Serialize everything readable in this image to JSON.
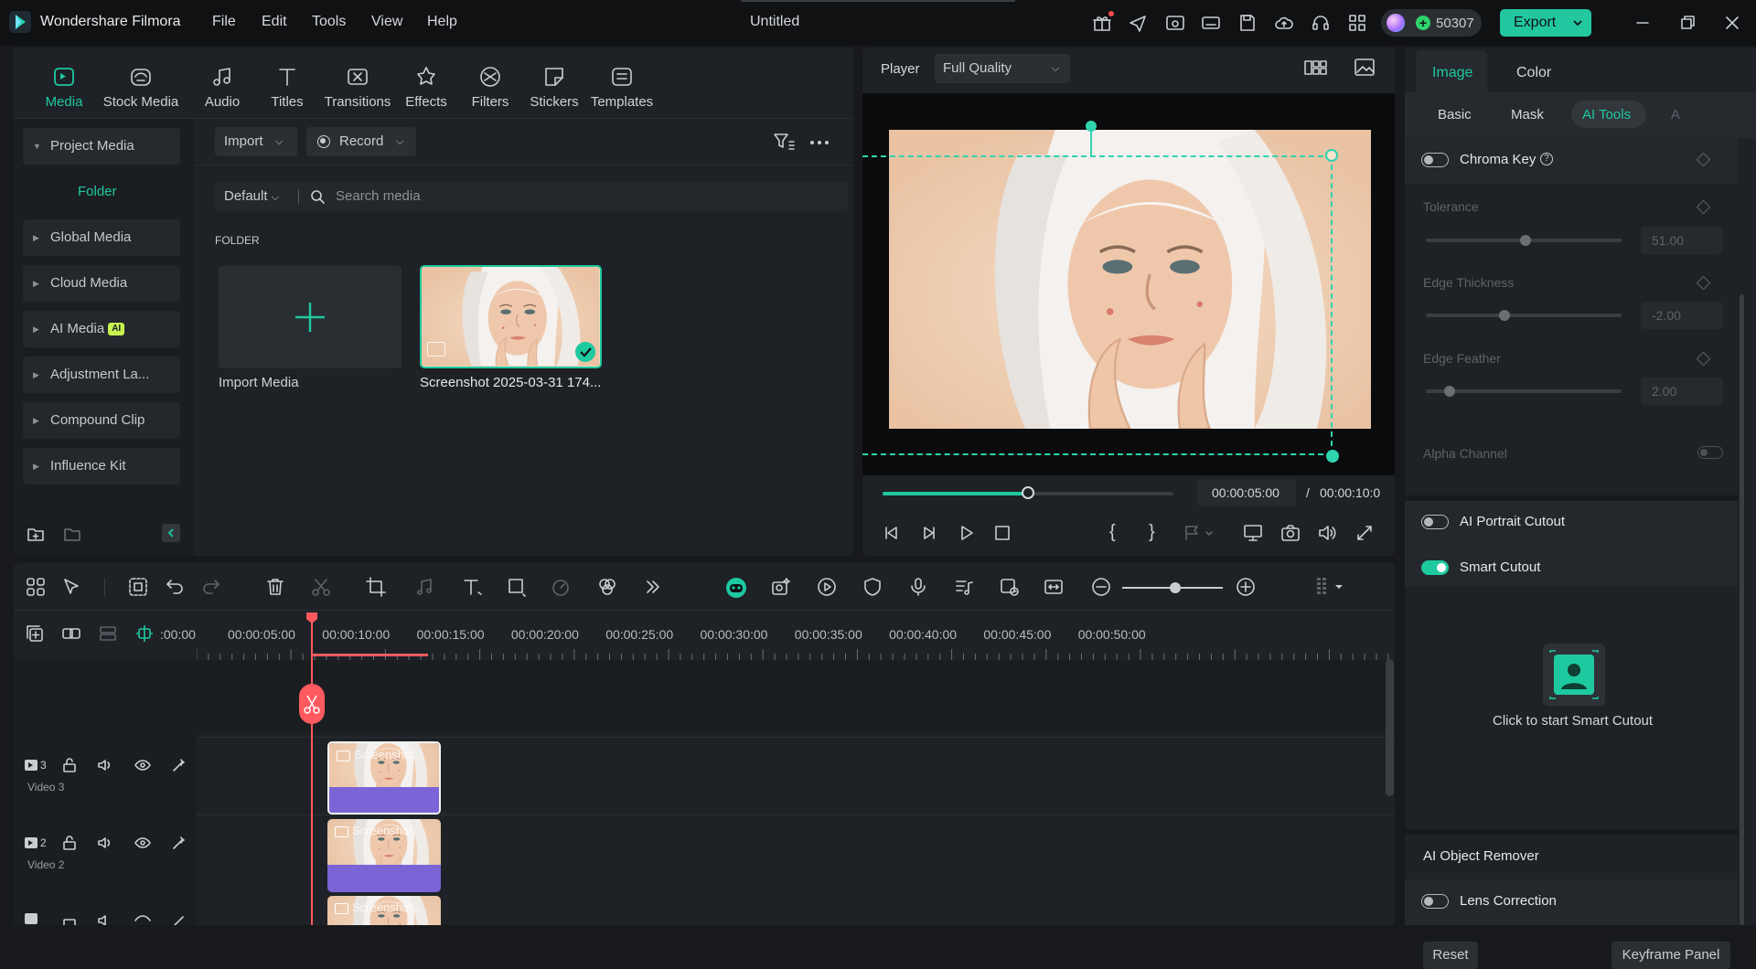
{
  "app": {
    "name": "Wondershare Filmora",
    "doc_title": "Untitled",
    "credits": "50307",
    "export_label": "Export"
  },
  "menu": [
    "File",
    "Edit",
    "Tools",
    "View",
    "Help"
  ],
  "media_tabs": [
    "Media",
    "Stock Media",
    "Audio",
    "Titles",
    "Transitions",
    "Effects",
    "Filters",
    "Stickers",
    "Templates"
  ],
  "sidebar": {
    "project_media": "Project Media",
    "folder": "Folder",
    "items": [
      "Global Media",
      "Cloud Media",
      "AI Media",
      "Adjustment La...",
      "Compound Clip",
      "Influence Kit"
    ],
    "ai_badge": "AI"
  },
  "media_toolbar": {
    "import": "Import",
    "record": "Record",
    "sort": "Default",
    "search_placeholder": "Search media"
  },
  "media_grid": {
    "section": "FOLDER",
    "import_label": "Import Media",
    "clip_label": "Screenshot 2025-03-31 174..."
  },
  "player": {
    "label": "Player",
    "quality": "Full Quality",
    "current_time": "00:00:05:00",
    "separator": "/",
    "total_time": "00:00:10:0",
    "progress": 0.5
  },
  "props": {
    "tabs": [
      "Image",
      "Color"
    ],
    "subtabs": [
      "Basic",
      "Mask",
      "AI Tools",
      "A"
    ],
    "chroma_key": "Chroma Key",
    "tolerance": {
      "label": "Tolerance",
      "value": "51.00",
      "level": 0.51
    },
    "edge_thickness": {
      "label": "Edge Thickness",
      "value": "-2.00",
      "level": 0.4
    },
    "edge_feather": {
      "label": "Edge Feather",
      "value": "2.00",
      "level": 0.12
    },
    "alpha_channel": "Alpha Channel",
    "ai_portrait": "AI Portrait Cutout",
    "smart_cutout": "Smart Cutout",
    "smart_cutout_hint": "Click to start Smart Cutout",
    "ai_object_remover": "AI Object Remover",
    "lens_correction": "Lens Correction",
    "reset": "Reset",
    "keyframe": "Keyframe Panel"
  },
  "timeline": {
    "ruler": [
      ":00:00",
      "00:00:05:00",
      "00:00:10:00",
      "00:00:15:00",
      "00:00:20:00",
      "00:00:25:00",
      "00:00:30:00",
      "00:00:35:00",
      "00:00:40:00",
      "00:00:45:00",
      "00:00:50:00"
    ],
    "tracks": [
      {
        "num": "3",
        "name": "Video 3"
      },
      {
        "num": "2",
        "name": "Video 2"
      }
    ],
    "clip_label": "Screenshot..."
  },
  "colors": {
    "accent": "#1ec9a0",
    "playhead": "#ff5a5f",
    "clip_bar": "#7a64d6"
  }
}
